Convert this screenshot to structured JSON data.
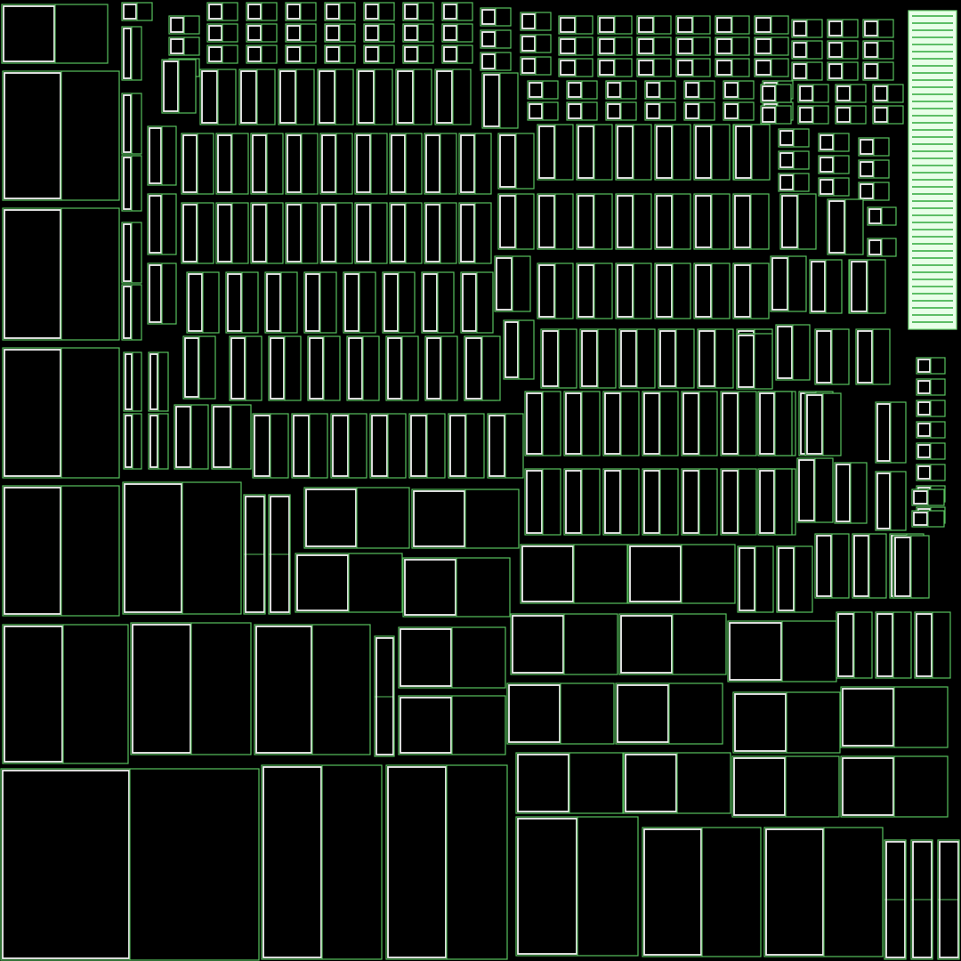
{
  "texture": {
    "background": "#000000",
    "island_outline": "#58c05e",
    "seam_highlight": "#f2f2f2",
    "strip_fill": "#e8ffe8",
    "strip_rung": "#2fa83a"
  }
}
